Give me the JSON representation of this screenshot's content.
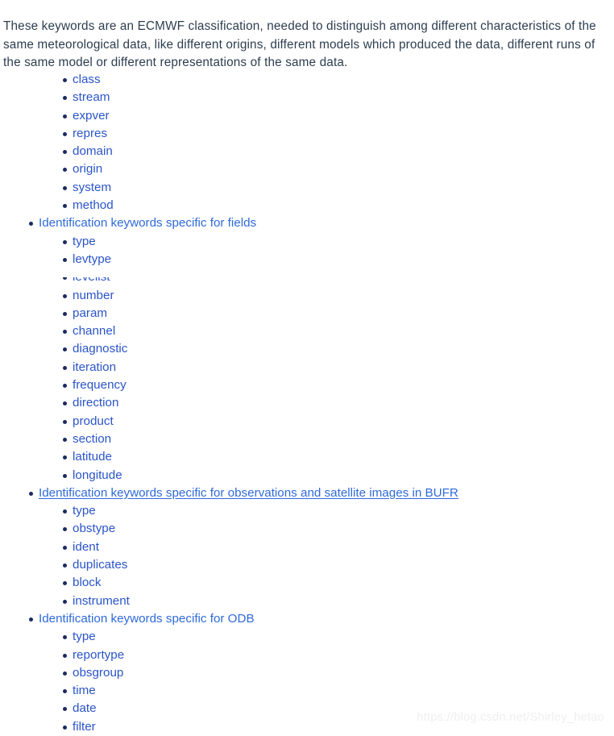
{
  "document": {
    "intro_paragraph": "These keywords are an ECMWF classification, needed to distinguish among different characteristics of the same meteorological data, like different origins, different models which produced the data, different runs of the same model or different representations of the same data.",
    "watermark": "https://blog.csdn.net/Shirley_hetao",
    "colors": {
      "body_text": "#2d3e50",
      "level1_link": "#2f6ad9",
      "level2_link": "#2b55c8",
      "bullet": "#1b2a5e",
      "watermark": "#efefef",
      "background": "#ffffff"
    }
  },
  "outline": {
    "leading_keywords": [
      {
        "label": "class"
      },
      {
        "label": "stream"
      },
      {
        "label": "expver"
      },
      {
        "label": "repres"
      },
      {
        "label": "domain"
      },
      {
        "label": "origin"
      },
      {
        "label": "system"
      },
      {
        "label": "method"
      }
    ],
    "sections": [
      {
        "heading": "Identification keywords specific for fields",
        "hovered": false,
        "items": [
          {
            "label": "type",
            "clipped": false
          },
          {
            "label": "levtype",
            "clipped": false
          },
          {
            "label": "levelist",
            "clipped": true
          },
          {
            "label": "number",
            "clipped": false
          },
          {
            "label": "param",
            "clipped": false
          },
          {
            "label": "channel",
            "clipped": false
          },
          {
            "label": "diagnostic",
            "clipped": false
          },
          {
            "label": "iteration",
            "clipped": false
          },
          {
            "label": "frequency",
            "clipped": false
          },
          {
            "label": "direction",
            "clipped": false
          },
          {
            "label": "product",
            "clipped": false
          },
          {
            "label": "section",
            "clipped": false
          },
          {
            "label": "latitude",
            "clipped": false
          },
          {
            "label": "longitude",
            "clipped": false
          }
        ]
      },
      {
        "heading": "Identification keywords specific for observations and satellite images in BUFR",
        "hovered": true,
        "items": [
          {
            "label": "type",
            "clipped": false
          },
          {
            "label": "obstype",
            "clipped": false
          },
          {
            "label": "ident",
            "clipped": false
          },
          {
            "label": "duplicates",
            "clipped": false
          },
          {
            "label": "block",
            "clipped": false
          },
          {
            "label": "instrument",
            "clipped": false
          }
        ]
      },
      {
        "heading": "Identification keywords specific for ODB",
        "hovered": false,
        "items": [
          {
            "label": "type",
            "clipped": false
          },
          {
            "label": "reportype",
            "clipped": false
          },
          {
            "label": "obsgroup",
            "clipped": false
          },
          {
            "label": "time",
            "clipped": false
          },
          {
            "label": "date",
            "clipped": false
          },
          {
            "label": "filter",
            "clipped": false
          }
        ]
      }
    ]
  }
}
